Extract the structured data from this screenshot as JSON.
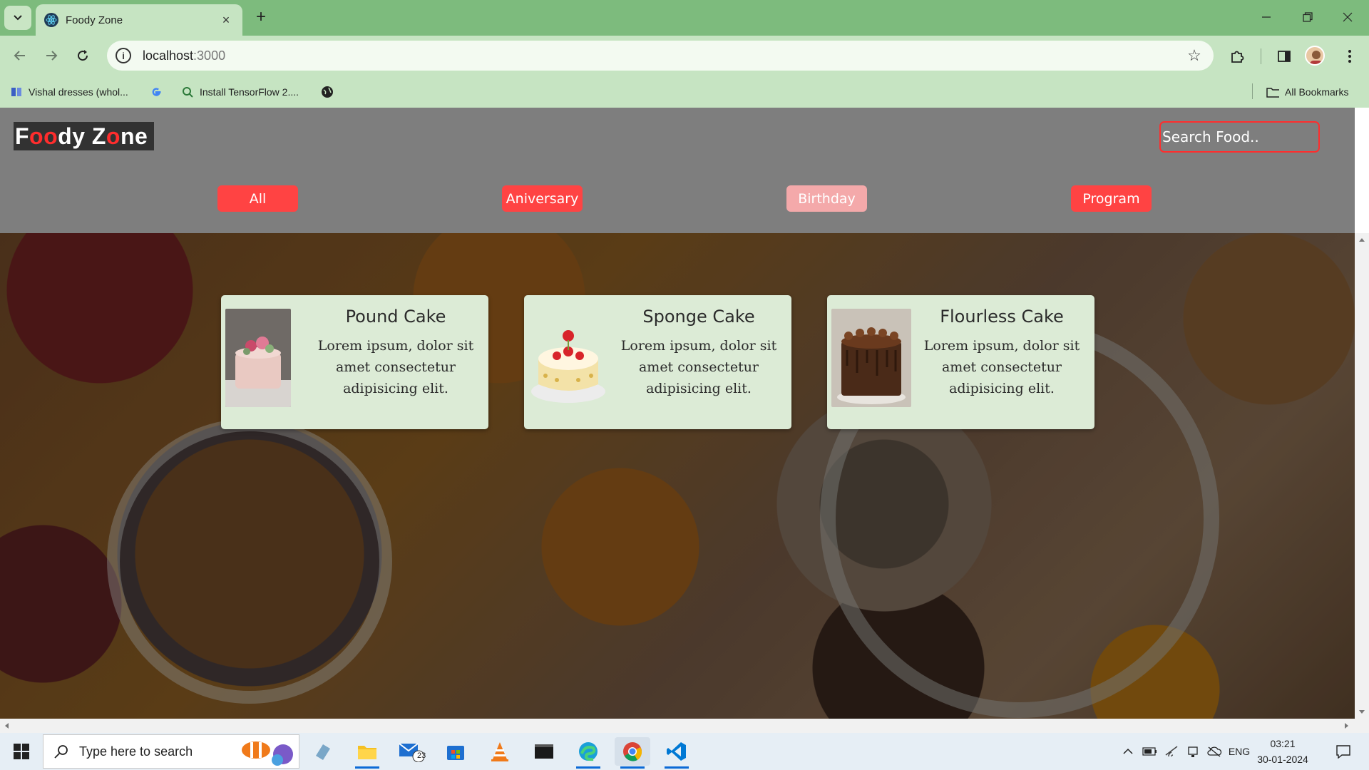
{
  "browser": {
    "tab_title": "Foody Zone",
    "tab_close": "×",
    "new_tab": "+",
    "url_host": "localhost",
    "url_port": ":3000",
    "bookmarks": [
      {
        "label": "Vishal dresses (whol...",
        "icon": "app-icon"
      },
      {
        "label": "",
        "icon": "google-icon"
      },
      {
        "label": "Install TensorFlow 2....",
        "icon": "search-icon"
      },
      {
        "label": "",
        "icon": "globe-icon"
      }
    ],
    "all_bookmarks": "All Bookmarks"
  },
  "app": {
    "logo_parts": [
      "F",
      "oo",
      "dy Z",
      "o",
      "ne"
    ],
    "search_placeholder": "Search Food..",
    "filters": [
      {
        "label": "All",
        "active": false
      },
      {
        "label": "Aniversary",
        "active": false
      },
      {
        "label": "Birthday",
        "active": true
      },
      {
        "label": "Program",
        "active": false
      }
    ],
    "cards": [
      {
        "title": "Pound Cake",
        "desc": "Lorem ipsum, dolor sit amet consectetur adipisicing elit.",
        "image": "pound-cake-image"
      },
      {
        "title": "Sponge Cake",
        "desc": "Lorem ipsum, dolor sit amet consectetur adipisicing elit.",
        "image": "sponge-cake-image"
      },
      {
        "title": "Flourless Cake",
        "desc": "Lorem ipsum, dolor sit amet consectetur adipisicing elit.",
        "image": "flourless-cake-image"
      }
    ],
    "colors": {
      "accent": "#ff4343",
      "active_filter": "#f4a9aa",
      "header_bg": "#7e7e7e",
      "card_bg": "#dcebd6"
    }
  },
  "taskbar": {
    "search_placeholder": "Type here to search",
    "mail_badge": "23",
    "lang": "ENG",
    "time": "03:21",
    "date": "30-01-2024"
  }
}
